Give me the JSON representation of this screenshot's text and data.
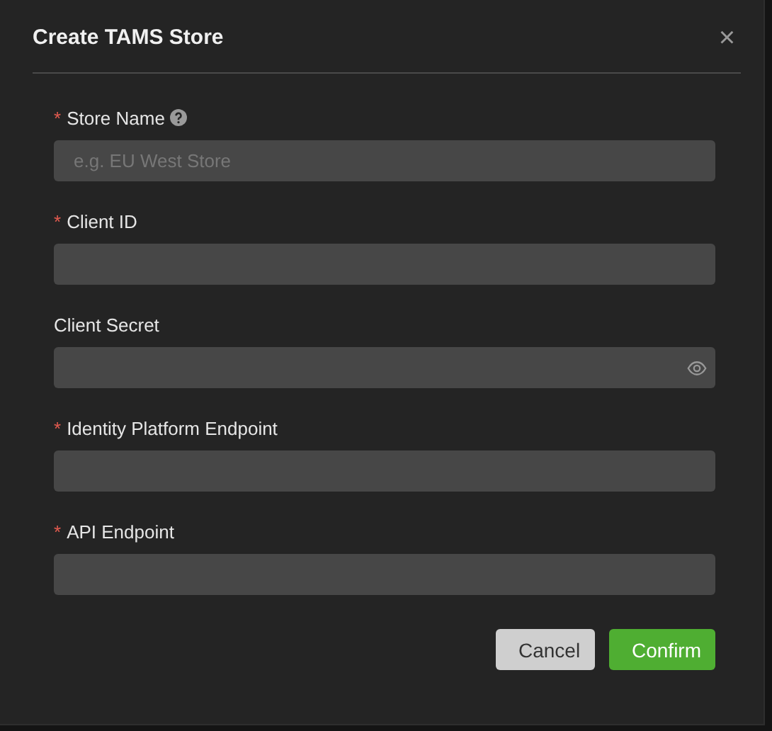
{
  "dialog": {
    "title": "Create TAMS Store",
    "close": "×"
  },
  "fields": [
    {
      "label": "Store Name",
      "required": true,
      "help": true,
      "kind": "text",
      "placeholder": "e.g. EU West Store"
    },
    {
      "label": "Client ID",
      "required": true,
      "help": false,
      "kind": "text"
    },
    {
      "label": "Client Secret",
      "required": false,
      "help": false,
      "kind": "password"
    },
    {
      "label": "Identity Platform Endpoint",
      "required": true,
      "help": false,
      "kind": "text"
    },
    {
      "label": "API Endpoint",
      "required": true,
      "help": false,
      "kind": "text"
    }
  ],
  "required_mark": "*",
  "buttons": [
    {
      "label": "Cancel",
      "kind": "secondary"
    },
    {
      "label": "Confirm",
      "kind": "primary"
    }
  ]
}
